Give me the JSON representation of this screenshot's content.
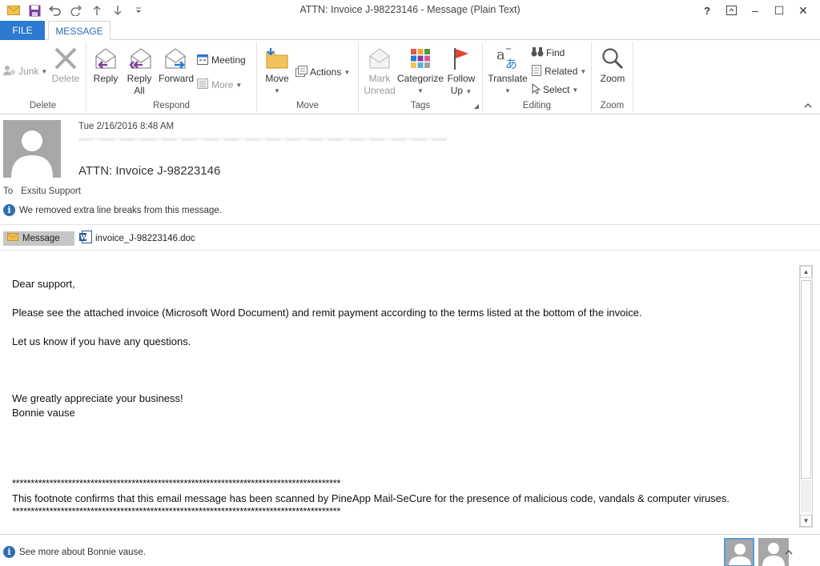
{
  "window": {
    "title": "ATTN: Invoice J-98223146 - Message (Plain Text)",
    "help": "?",
    "minimize": "–",
    "restore": "☐",
    "close": "✕"
  },
  "tabs": {
    "file": "FILE",
    "message": "MESSAGE"
  },
  "ribbon": {
    "delete_group": {
      "label": "Delete",
      "junk": "Junk",
      "delete": "Delete"
    },
    "respond_group": {
      "label": "Respond",
      "reply": "Reply",
      "reply_all_1": "Reply",
      "reply_all_2": "All",
      "forward": "Forward",
      "meeting": "Meeting",
      "more": "More"
    },
    "move_group": {
      "label": "Move",
      "move": "Move",
      "actions": "Actions"
    },
    "tags_group": {
      "label": "Tags",
      "mark_unread_1": "Mark",
      "mark_unread_2": "Unread",
      "categorize": "Categorize",
      "follow_up_1": "Follow",
      "follow_up_2": "Up"
    },
    "editing_group": {
      "label": "Editing",
      "translate": "Translate",
      "find": "Find",
      "related": "Related",
      "select": "Select"
    },
    "zoom_group": {
      "label": "Zoom",
      "zoom": "Zoom"
    }
  },
  "header": {
    "date": "Tue 2/16/2016 8:48 AM",
    "subject": "ATTN: Invoice J-98223146",
    "to_label": "To",
    "to_value": "Exsitu Support",
    "info": "We removed extra line breaks from this message."
  },
  "attachments": {
    "message_tab": "Message",
    "file_name": "invoice_J-98223146.doc"
  },
  "body": {
    "lines": [
      "Dear support,",
      "Please see the attached invoice (Microsoft Word Document) and remit payment according to the terms listed at the bottom of the invoice.",
      "Let us know if you have any questions.",
      "We greatly appreciate your business!",
      "Bonnie vause",
      "****************************************************************************************",
      "This footnote confirms that this email message has been scanned by PineApp Mail-SeCure for the presence of malicious code, vandals & computer viruses.",
      "****************************************************************************************"
    ]
  },
  "footer": {
    "info": "See more about Bonnie vause."
  },
  "colors": {
    "accent": "#2b79d0",
    "info_blue": "#2f6db5",
    "avatar_gray": "#a7a7a7"
  }
}
